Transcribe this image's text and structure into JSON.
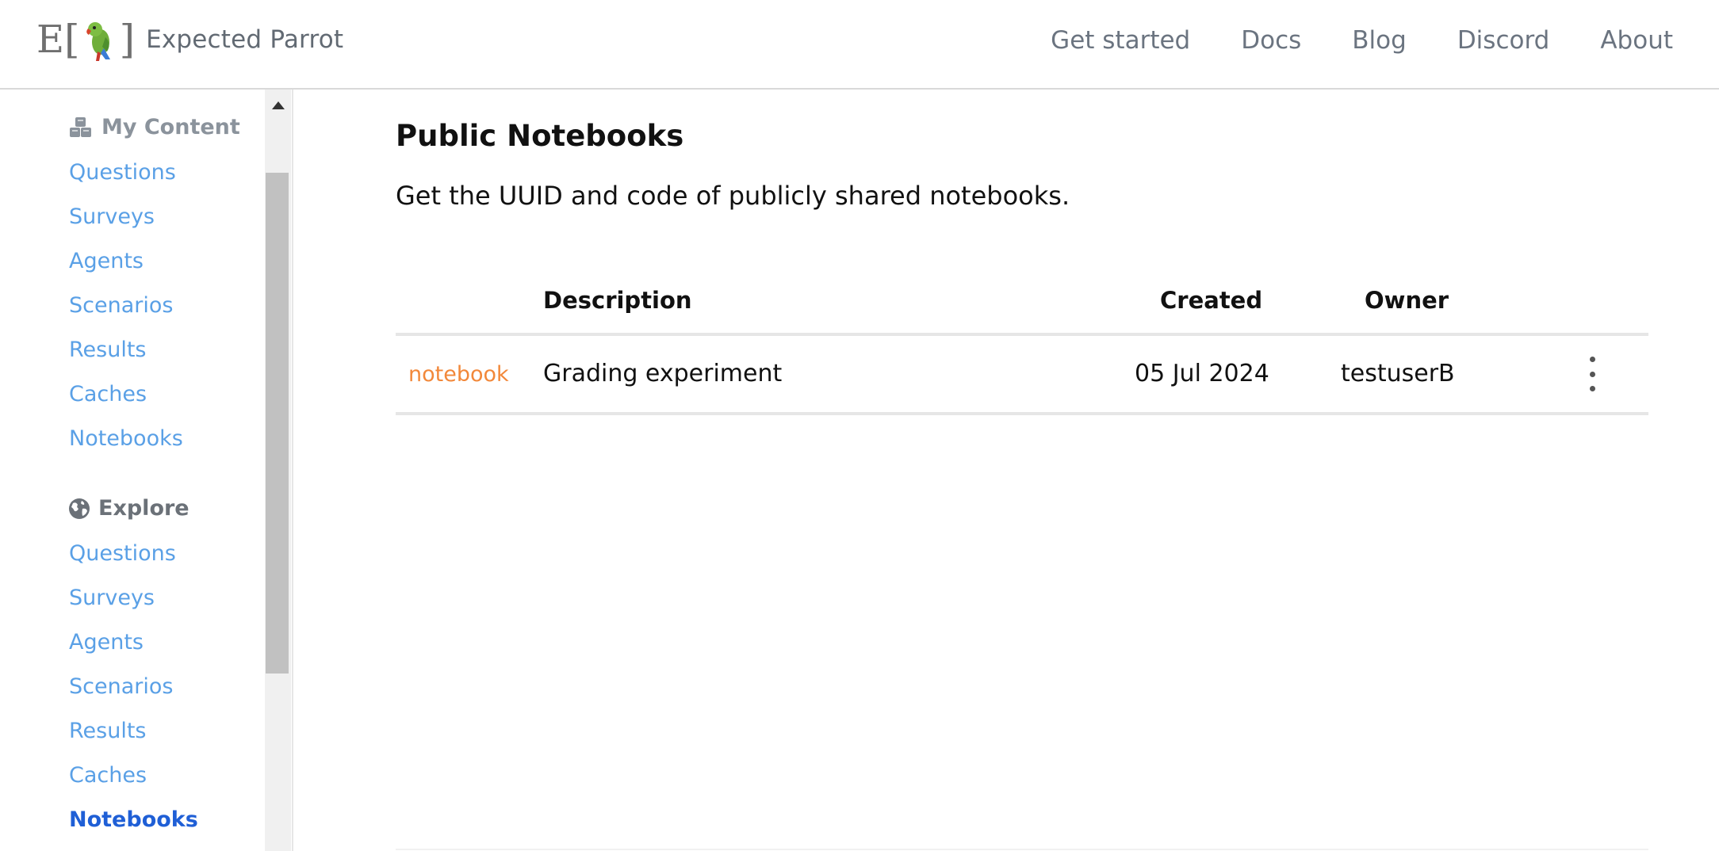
{
  "brand": {
    "name": "Expected Parrot",
    "logo_letter": "E"
  },
  "nav": [
    {
      "label": "Get started"
    },
    {
      "label": "Docs"
    },
    {
      "label": "Blog"
    },
    {
      "label": "Discord"
    },
    {
      "label": "About"
    }
  ],
  "sidebar": {
    "my_content": {
      "title": "My Content",
      "icon": "cubes-icon",
      "items": [
        "Questions",
        "Surveys",
        "Agents",
        "Scenarios",
        "Results",
        "Caches",
        "Notebooks"
      ]
    },
    "explore": {
      "title": "Explore",
      "icon": "globe-icon",
      "items": [
        "Questions",
        "Surveys",
        "Agents",
        "Scenarios",
        "Results",
        "Caches",
        "Notebooks"
      ],
      "active": "Notebooks"
    }
  },
  "main": {
    "title": "Public Notebooks",
    "subtitle": "Get the UUID and code of publicly shared notebooks.",
    "table": {
      "headers": {
        "description": "Description",
        "created": "Created",
        "owner": "Owner"
      },
      "rows": [
        {
          "type": "notebook",
          "description": "Grading experiment",
          "created": "05 Jul 2024",
          "owner": "testuserB"
        }
      ]
    }
  },
  "colors": {
    "link": "#5aa0e6",
    "active_link": "#1f5fd6",
    "badge": "#f2883a"
  }
}
